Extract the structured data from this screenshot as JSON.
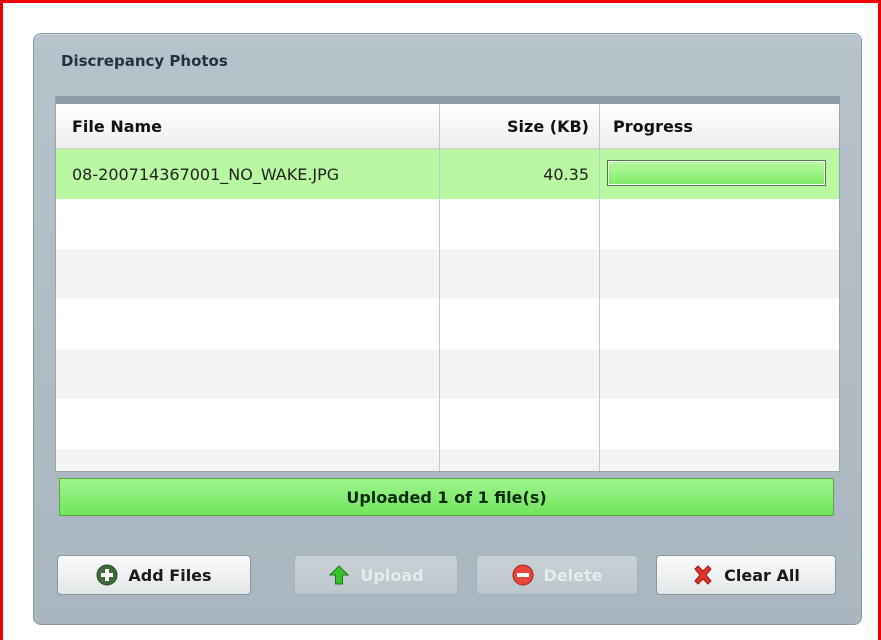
{
  "panel": {
    "title": "Discrepancy Photos"
  },
  "grid": {
    "columns": [
      "File Name",
      "Size (KB)",
      "Progress"
    ],
    "rows": [
      {
        "file_name": "08-200714367001_NO_WAKE.JPG",
        "size_kb": "40.35",
        "progress": 1.0,
        "selected": true
      }
    ]
  },
  "status": {
    "text": "Uploaded 1 of 1 file(s)"
  },
  "buttons": {
    "add_files": "Add Files",
    "upload": "Upload",
    "delete": "Delete",
    "clear_all": "Clear All"
  },
  "icons": {
    "add_files": "plus-circle-icon",
    "upload": "arrow-up-icon",
    "delete": "minus-circle-icon",
    "clear_all": "x-icon"
  },
  "colors": {
    "frame": "#ee0000",
    "selected_row": "#b9f7a3",
    "status_bar": "#7fec67"
  }
}
